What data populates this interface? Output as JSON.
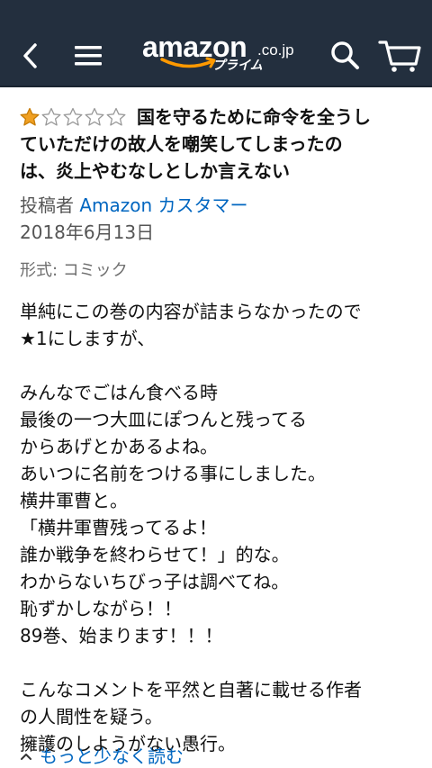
{
  "header": {
    "logo_text": "amazon",
    "logo_domain": ".co.jp",
    "logo_prime": "プライム",
    "icons": {
      "back": "back-arrow-icon",
      "menu": "hamburger-menu-icon",
      "search": "search-icon",
      "cart": "cart-icon"
    },
    "background_color": "#232f3e"
  },
  "review": {
    "rating": 1,
    "rating_max": 5,
    "star_color": "#f0a022",
    "title_lines": [
      "国を守るために命令を全うし",
      "ていただけの故人を嘲笑してしまったの",
      "は、炎上やむなしとしか言えない"
    ],
    "author_prefix": "投稿者",
    "author_name": "Amazon カスタマー",
    "date": "2018年6月13日",
    "format": "形式: コミック",
    "body_lines": [
      "単純にこの巻の内容が詰まらなかったので",
      "★1にしますが、",
      "",
      "みんなでごはん食べる時",
      "最後の一つ大皿にぽつんと残ってる",
      "からあげとかあるよね。",
      "あいつに名前をつける事にしました。",
      "横井軍曹と。",
      "「横井軍曹残ってるよ！",
      "誰か戦争を終わらせて！」的な。",
      "わからないちびっ子は調べてね。",
      "恥ずかしながら！！",
      "89巻、始まります！！！",
      "",
      "こんなコメントを平然と自著に載せる作者",
      "の人間性を疑う。",
      "擁護のしようがない愚行。"
    ],
    "read_less_label": "もっと少なく読む",
    "link_color": "#0066c0"
  }
}
